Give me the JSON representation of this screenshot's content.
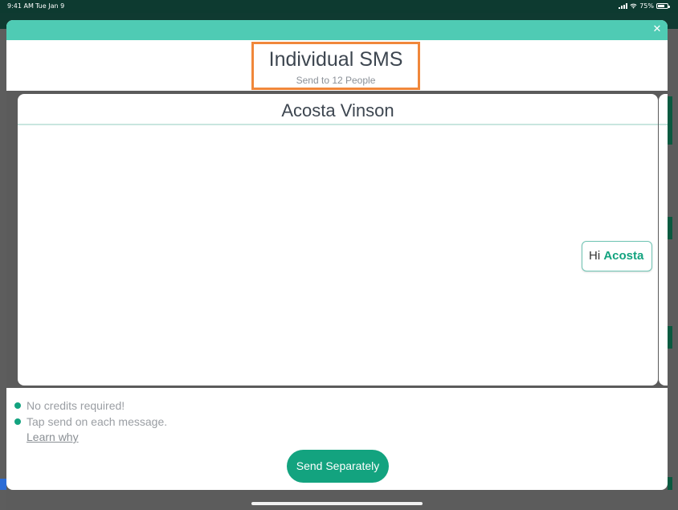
{
  "status_bar": {
    "time": "9:41 AM",
    "date": "Tue Jan 9",
    "battery": "75%",
    "battery_level": 0.75,
    "icons": [
      "signal-icon",
      "wifi-icon",
      "battery-icon"
    ]
  },
  "modal": {
    "close_icon": "close-icon",
    "title": "Individual SMS",
    "subtitle": "Send to 12 People"
  },
  "card": {
    "recipient_name": "Acosta Vinson",
    "message_greeting": "Hi",
    "message_name": "Acosta"
  },
  "info": {
    "items": [
      "No credits required!",
      "Tap send on each message."
    ],
    "learn_link": "Learn why"
  },
  "send_button": "Send Separately",
  "colors": {
    "accent": "#13a37f",
    "header_bar": "#4fcbb4",
    "highlight_border": "#f0873a",
    "status_bar": "#0d3a30"
  }
}
